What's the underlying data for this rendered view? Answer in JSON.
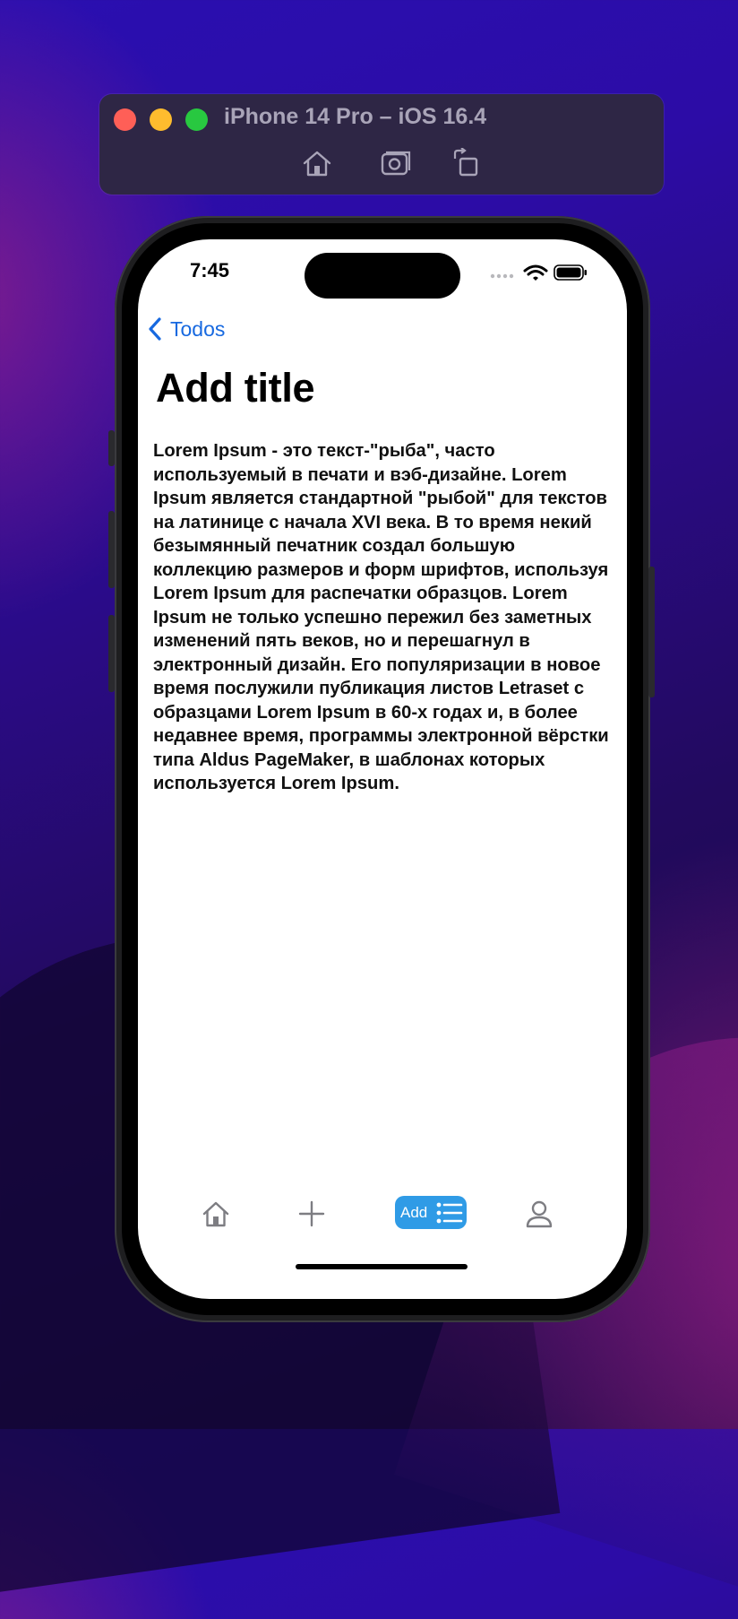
{
  "simulator": {
    "window_title": "iPhone 14 Pro – iOS 16.4",
    "toolbar_icons": [
      "home-icon",
      "screenshot-icon",
      "rotate-icon"
    ]
  },
  "status_bar": {
    "time": "7:45",
    "icons": [
      "cellular-icon",
      "wifi-icon",
      "battery-icon"
    ]
  },
  "nav": {
    "back_label": "Todos",
    "back_icon": "chevron-left-icon"
  },
  "content": {
    "title": "Add title",
    "body": "Lorem Ipsum - это текст-\"рыба\", часто используемый в печати и вэб-дизайне. Lorem Ipsum является стандартной \"рыбой\" для текстов на латинице с начала XVI века. В то время некий безымянный печатник создал большую коллекцию размеров и форм шрифтов, используя Lorem Ipsum для распечатки образцов. Lorem Ipsum не только успешно пережил без заметных изменений пять веков, но и перешагнул в электронный дизайн. Его популяризации в новое время послужили публикация листов Letraset с образцами Lorem Ipsum в 60-х годах и, в более недавнее время, программы электронной вёрстки типа Aldus PageMaker, в шаблонах которых используется Lorem Ipsum."
  },
  "tab_bar": {
    "items": [
      {
        "icon": "home-icon"
      },
      {
        "icon": "plus-icon"
      },
      {
        "icon": "list-icon",
        "label": "Add",
        "selected": true
      },
      {
        "icon": "person-icon"
      }
    ]
  },
  "colors": {
    "accent": "#1769e0",
    "selected_tab": "#2f9be6"
  }
}
